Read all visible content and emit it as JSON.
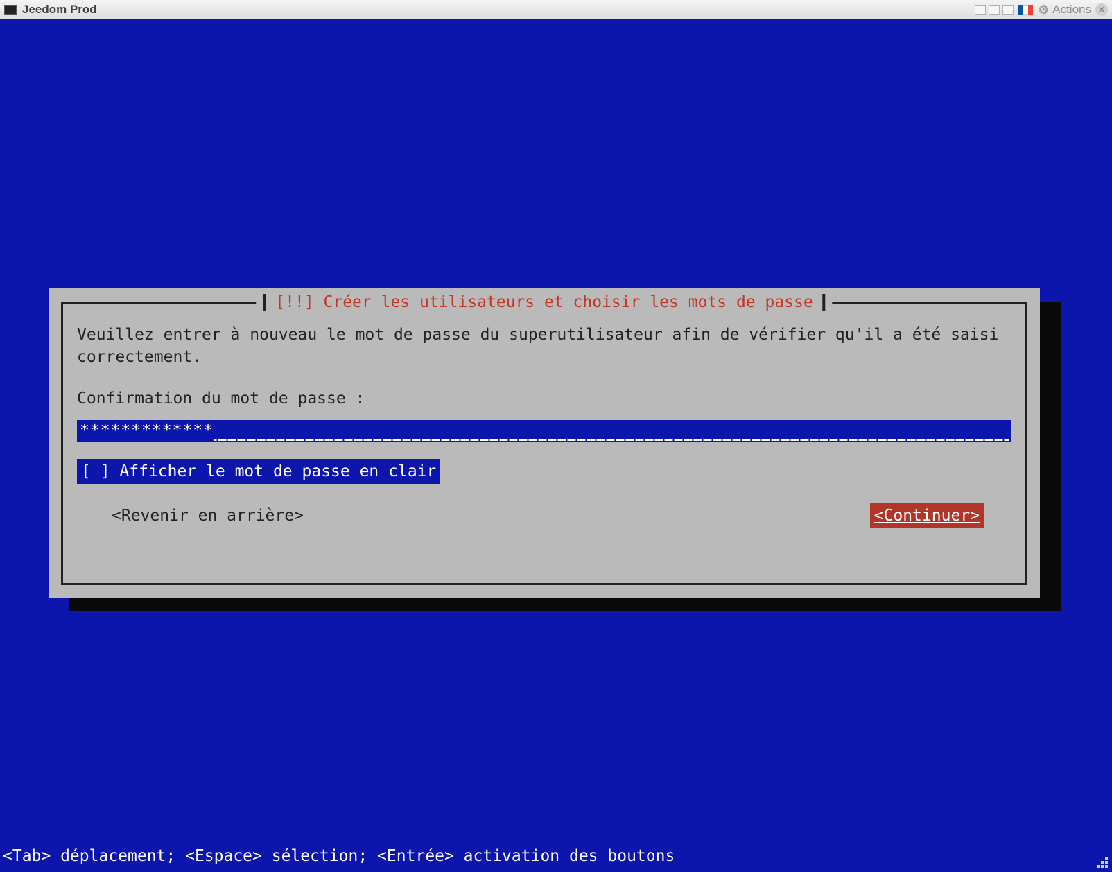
{
  "titlebar": {
    "app_name": "Jeedom Prod",
    "actions_label": "Actions"
  },
  "dialog": {
    "title": "[!!] Créer les utilisateurs et choisir les mots de passe",
    "prompt": "Veuillez entrer à nouveau le mot de passe du superutilisateur afin de vérifier qu'il a été saisi correctement.",
    "field_label": "Confirmation du mot de passe :",
    "password_value": "*************",
    "checkbox_marker": "[ ]",
    "checkbox_label": "Afficher le mot de passe en clair",
    "back_label": "<Revenir en arrière>",
    "continue_label": "<Continuer>"
  },
  "hint": "<Tab> déplacement; <Espace> sélection; <Entrée> activation des boutons"
}
